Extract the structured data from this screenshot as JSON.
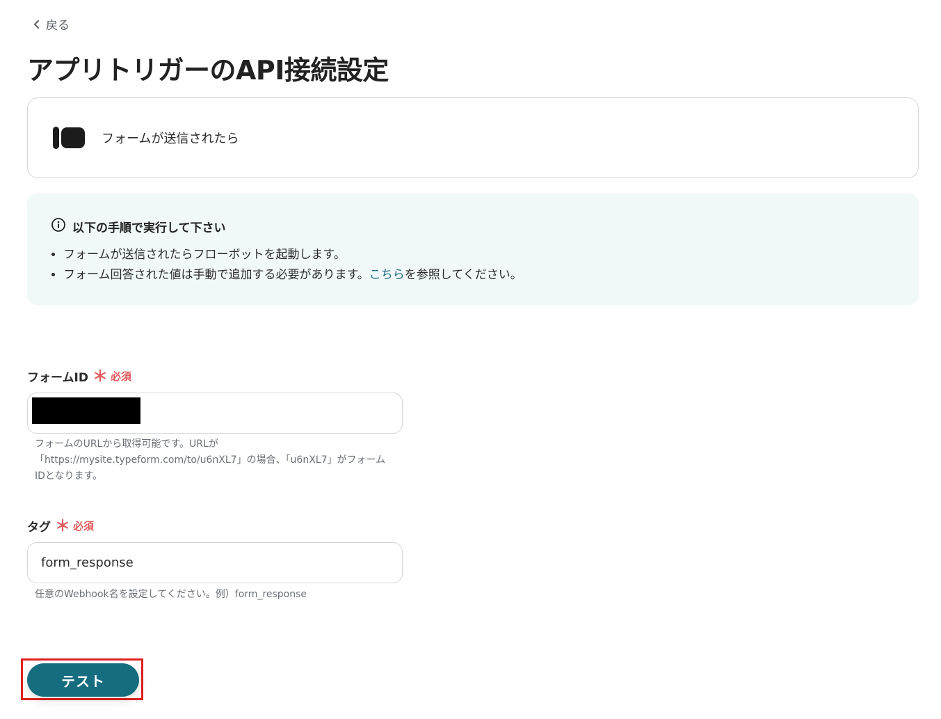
{
  "nav": {
    "back_label": "戻る"
  },
  "page": {
    "title": "アプリトリガーのAPI接続設定"
  },
  "trigger": {
    "label": "フォームが送信されたら"
  },
  "instructions": {
    "title": "以下の手順で実行して下さい",
    "item1": "フォームが送信されたらフローボットを起動します。",
    "item2_prefix": "フォーム回答された値は手動で追加する必要があります。",
    "item2_link": "こちら",
    "item2_suffix": "を参照してください。"
  },
  "form_id_field": {
    "label": "フォームID",
    "required_mark": "＊",
    "required_label": "必須",
    "value": "",
    "help_line1": "フォームのURLから取得可能です。URLが",
    "help_line2": "「https://mysite.typeform.com/to/u6nXL7」の場合、「u6nXL7」がフォーム",
    "help_line3": "IDとなります。"
  },
  "tag_field": {
    "label": "タグ",
    "required_mark": "＊",
    "required_label": "必須",
    "value": "form_response",
    "help": "任意のWebhook名を設定してください。例）form_response"
  },
  "actions": {
    "test_label": "テスト"
  },
  "colors": {
    "primary": "#176d80",
    "required": "#e05a5a",
    "info_bg": "#f1f9f8",
    "link": "#1a6a80",
    "highlight_frame": "#e02020"
  }
}
